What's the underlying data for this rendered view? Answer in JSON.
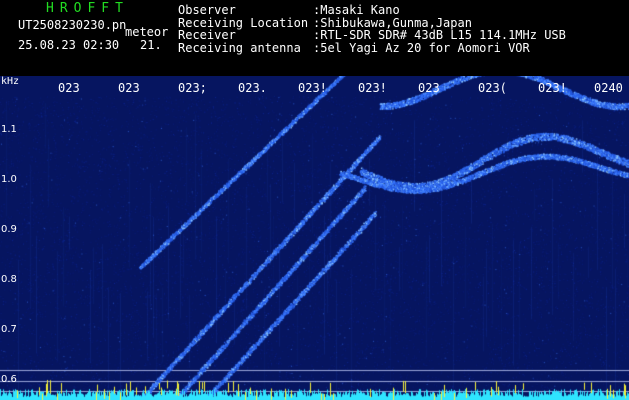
{
  "header": {
    "app_name": "HROFFT",
    "file_name": "UT2508230230.pn",
    "file_suffix": "meteor",
    "date_time": "25.08.23 02:30",
    "count": "21.",
    "info": [
      {
        "label": "Observer",
        "value": ":Masaki Kano"
      },
      {
        "label": "Receiving Location",
        "value": ":Shibukawa,Gunma,Japan"
      },
      {
        "label": "Receiver",
        "value": ":RTL-SDR SDR# 43dB L15 114.1MHz USB"
      },
      {
        "label": "Receiving antenna",
        "value": ":5el Yagi Az 20 for Aomori VOR"
      }
    ]
  },
  "spectrogram": {
    "unit": "kHz",
    "y_ticks": [
      "1.1",
      "1.0",
      "0.9",
      "0.8",
      "0.7",
      "0.6"
    ],
    "y_values": [
      1.1,
      1.0,
      0.9,
      0.8,
      0.7,
      0.6
    ],
    "x_ticks": [
      "023",
      "023",
      "023;",
      "023.",
      "023!",
      "023!",
      "023",
      "023(",
      "023!",
      "0240"
    ],
    "colors": {
      "background": "#061560",
      "trace": "#3b7bff",
      "bright": "#8ec8ff",
      "noise": "#2fe5ff",
      "yellow": "#f6f23a"
    }
  }
}
